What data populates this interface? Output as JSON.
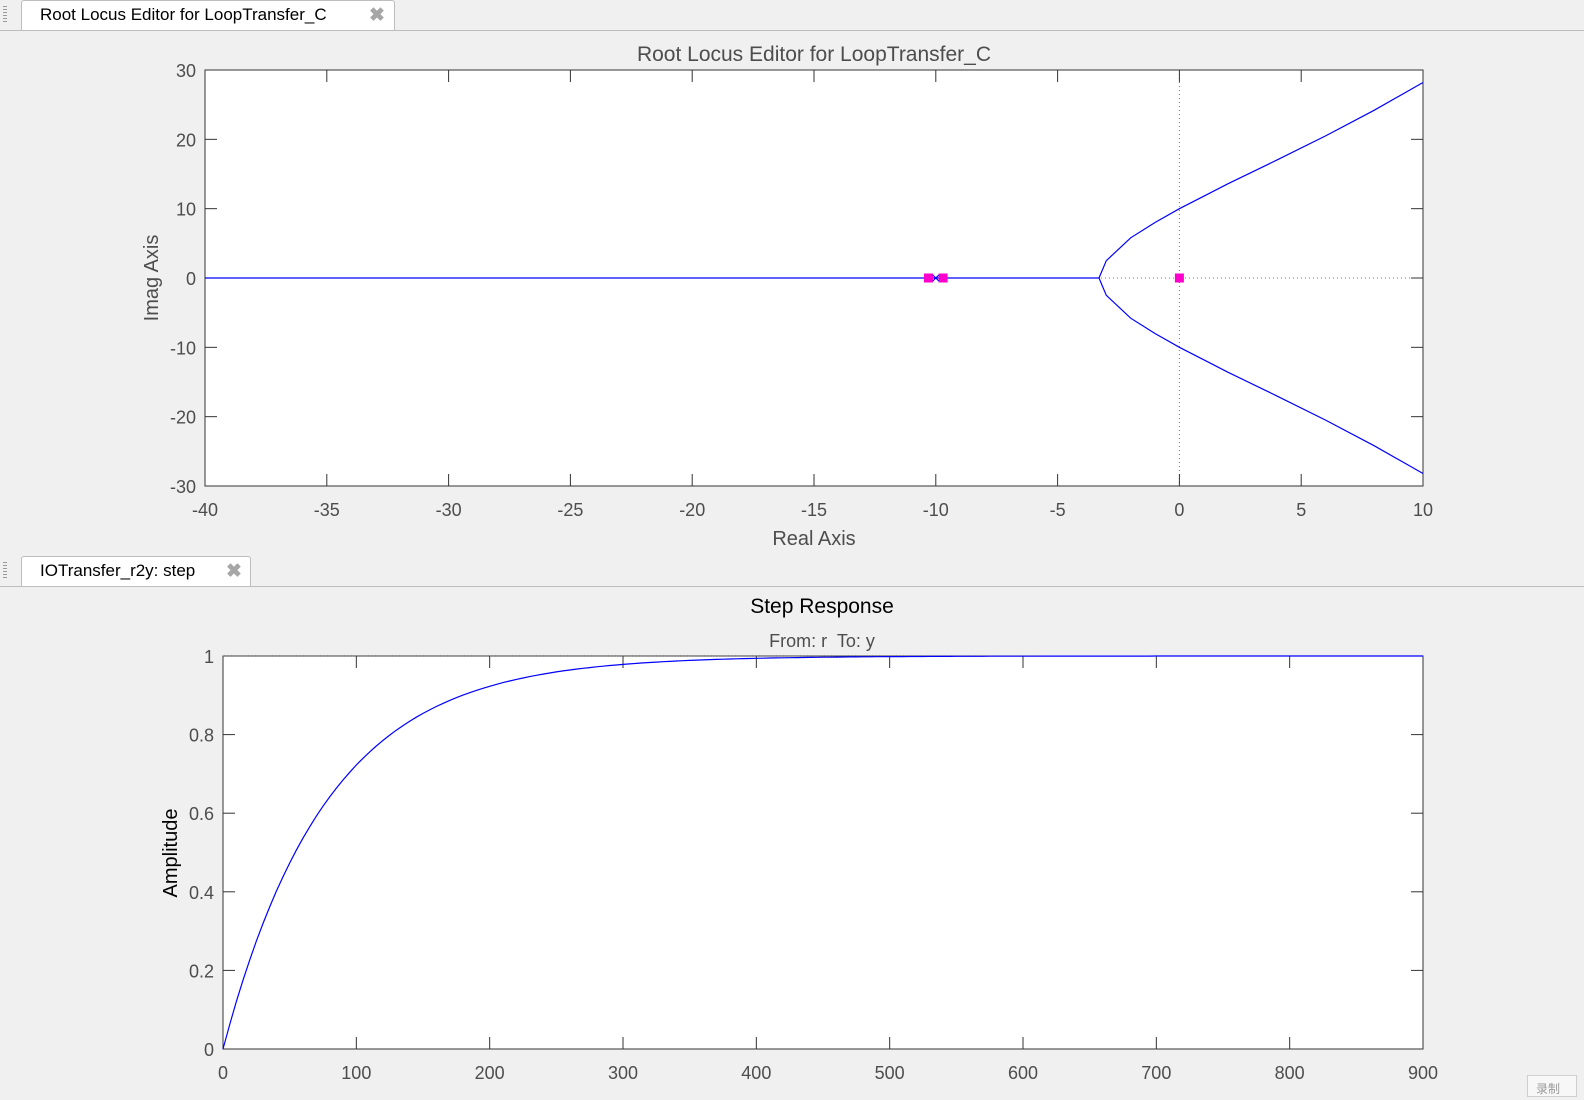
{
  "top_tab": {
    "label": "Root Locus Editor for LoopTransfer_C"
  },
  "bottom_tab": {
    "label": "IOTransfer_r2y: step"
  },
  "corner_button": {
    "label": "录制"
  },
  "colors": {
    "locus": "#0000ff",
    "pole_zero": "#ff00cc",
    "axis": "#333333",
    "text": "#4d4d4d"
  },
  "chart_data": [
    {
      "type": "line",
      "title": "Root Locus Editor for LoopTransfer_C",
      "xlabel": "Real Axis",
      "ylabel": "Imag Axis",
      "xlim": [
        -40,
        10
      ],
      "ylim": [
        -30,
        30
      ],
      "xticks": [
        "-40",
        "-35",
        "-30",
        "-25",
        "-20",
        "-15",
        "-10",
        "-5",
        "0",
        "5",
        "10"
      ],
      "yticks": [
        "30",
        "20",
        "10",
        "0",
        "-10",
        "-20",
        "-30"
      ],
      "real_axis_branch": {
        "x": [
          -40,
          -3.3
        ]
      },
      "upper_branch": {
        "x": [
          -3.3,
          -3,
          -2,
          -1,
          0,
          1,
          2,
          4,
          6,
          8,
          10
        ],
        "y": [
          0,
          2.5,
          5.8,
          8.0,
          10.0,
          11.8,
          13.6,
          17.0,
          20.5,
          24.2,
          28.2
        ]
      },
      "lower_branch": {
        "x": [
          -3.3,
          -3,
          -2,
          -1,
          0,
          1,
          2,
          4,
          6,
          8,
          10
        ],
        "y": [
          0,
          -2.5,
          -5.8,
          -8.0,
          -10.0,
          -11.8,
          -13.6,
          -17.0,
          -20.5,
          -24.2,
          -28.2
        ]
      },
      "markers": [
        {
          "x": -10.3,
          "y": 0,
          "kind": "square"
        },
        {
          "x": -9.7,
          "y": 0,
          "kind": "square"
        },
        {
          "x": -10.0,
          "y": 0,
          "kind": "x"
        },
        {
          "x": 0,
          "y": 0,
          "kind": "square"
        }
      ]
    },
    {
      "type": "line",
      "title": "Step Response",
      "subtitle": "From: r  To: y",
      "xlabel": "",
      "ylabel": "Amplitude",
      "xlim": [
        0,
        900
      ],
      "ylim": [
        0,
        1
      ],
      "xticks": [
        "0",
        "100",
        "200",
        "300",
        "400",
        "500",
        "600",
        "700",
        "800",
        "900"
      ],
      "yticks": [
        "1",
        "0.8",
        "0.6",
        "0.4",
        "0.2",
        "0"
      ],
      "series": [
        {
          "time_constant": 78,
          "final_value": 1
        }
      ]
    }
  ]
}
